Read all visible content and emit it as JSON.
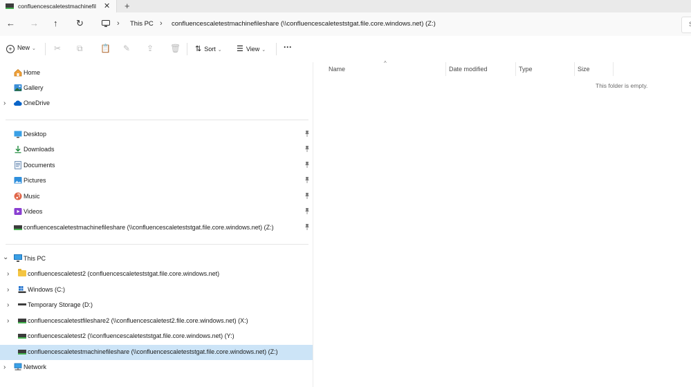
{
  "tab": {
    "title": "confluencescaletestmachinefil",
    "close": "✕",
    "new_tab": "+"
  },
  "nav": {
    "back": "←",
    "forward": "→",
    "up": "↑",
    "refresh": "↻"
  },
  "address": {
    "chevron": "›",
    "crumbs": [
      "This PC",
      "confluencescaletestmachinefileshare (\\\\confluencescaleteststgat.file.core.windows.net) (Z:)"
    ],
    "search_placeholder": "S"
  },
  "toolbar": {
    "new_label": "New",
    "sort_label": "Sort",
    "view_label": "View",
    "more": "···",
    "caret": "⌄"
  },
  "sidebar": {
    "chevron_collapsed": "›",
    "chevron_expanded": "⌄",
    "pin": "📌",
    "top": [
      {
        "label": "Home",
        "icon": "home-icon"
      },
      {
        "label": "Gallery",
        "icon": "gallery-icon"
      },
      {
        "label": "OneDrive",
        "icon": "cloud-icon"
      }
    ],
    "quick_access": [
      {
        "label": "Desktop",
        "icon": "desktop-icon"
      },
      {
        "label": "Downloads",
        "icon": "download-icon"
      },
      {
        "label": "Documents",
        "icon": "documents-icon"
      },
      {
        "label": "Pictures",
        "icon": "pictures-icon"
      },
      {
        "label": "Music",
        "icon": "music-icon"
      },
      {
        "label": "Videos",
        "icon": "videos-icon"
      },
      {
        "label": "confluencescaletestmachinefileshare (\\\\confluencescaleteststgat.file.core.windows.net) (Z:)",
        "icon": "network-drive-icon"
      }
    ],
    "this_pc": {
      "label": "This PC",
      "icon": "computer-icon"
    },
    "drives": [
      {
        "label": "confluencescaletest2 (confluencescaleteststgat.file.core.windows.net)",
        "icon": "folder-icon"
      },
      {
        "label": "Windows (C:)",
        "icon": "windows-drive-icon"
      },
      {
        "label": "Temporary Storage (D:)",
        "icon": "drive-icon"
      },
      {
        "label": "confluencescaletestfileshare2 (\\\\confluencescaletest2.file.core.windows.net) (X:)",
        "icon": "network-drive-icon"
      },
      {
        "label": "confluencescaletest2 (\\\\confluencescaleteststgat.file.core.windows.net) (Y:)",
        "icon": "network-drive-icon"
      },
      {
        "label": "confluencescaletestmachinefileshare (\\\\confluencescaleteststgat.file.core.windows.net) (Z:)",
        "icon": "network-drive-icon",
        "selected": true
      }
    ],
    "network": {
      "label": "Network",
      "icon": "network-icon"
    }
  },
  "content": {
    "columns": [
      "Name",
      "Date modified",
      "Type",
      "Size"
    ],
    "sort_indicator": "^",
    "empty_message": "This folder is empty."
  },
  "colors": {
    "selected_bg": "#cce4f7",
    "accent": "#0067c0",
    "drive_green": "#44b24f"
  }
}
